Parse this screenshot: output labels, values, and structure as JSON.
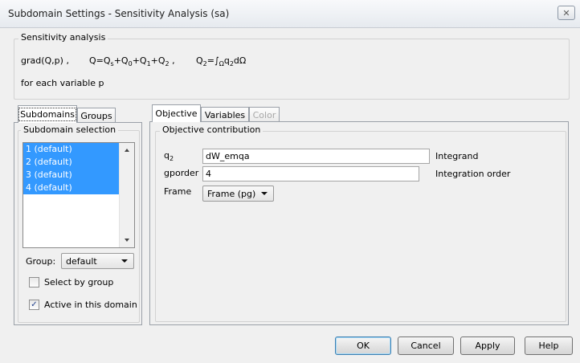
{
  "window": {
    "title": "Subdomain Settings - Sensitivity Analysis (sa)",
    "close_glyph": "✕"
  },
  "sensitivity": {
    "group_title": "Sensitivity analysis",
    "formula1_prefix": "grad(Q,p) ,",
    "formula2": {
      "q": "Q=Q",
      "s": "s",
      "p0": "+Q",
      "s0": "0",
      "p1": "+Q",
      "s1": "1",
      "p2": "+Q",
      "s2": "2",
      "end": " ,"
    },
    "formula3": {
      "q": "Q",
      "s2": "2",
      "eq": "=∫",
      "omega": "Ω",
      "q2": "q",
      "s2b": "2",
      "tail": "dΩ"
    },
    "footer": "for each variable p"
  },
  "left_tabs": [
    {
      "label": "Subdomains"
    },
    {
      "label": "Groups"
    }
  ],
  "subdomain_selection": {
    "title": "Subdomain selection",
    "items": [
      "1 (default)",
      "2 (default)",
      "3 (default)",
      "4 (default)"
    ],
    "group_label": "Group:",
    "group_value": "default",
    "select_by_group": "Select by group",
    "active_in_domain": "Active in this domain",
    "select_by_group_checked": false,
    "active_checked": true,
    "check_glyph": "✓"
  },
  "right_tabs": [
    {
      "label": "Objective"
    },
    {
      "label": "Variables"
    },
    {
      "label": "Color"
    }
  ],
  "objective": {
    "group_title": "Objective contribution",
    "q2_label_base": "q",
    "q2_label_sub": "2",
    "q2_value": "dW_emqa",
    "q2_desc": "Integrand",
    "gporder_label": "gporder",
    "gporder_value": "4",
    "gporder_desc": "Integration order",
    "frame_label": "Frame",
    "frame_value": "Frame (pg)"
  },
  "buttons": {
    "ok": "OK",
    "cancel": "Cancel",
    "apply": "Apply",
    "help": "Help"
  }
}
